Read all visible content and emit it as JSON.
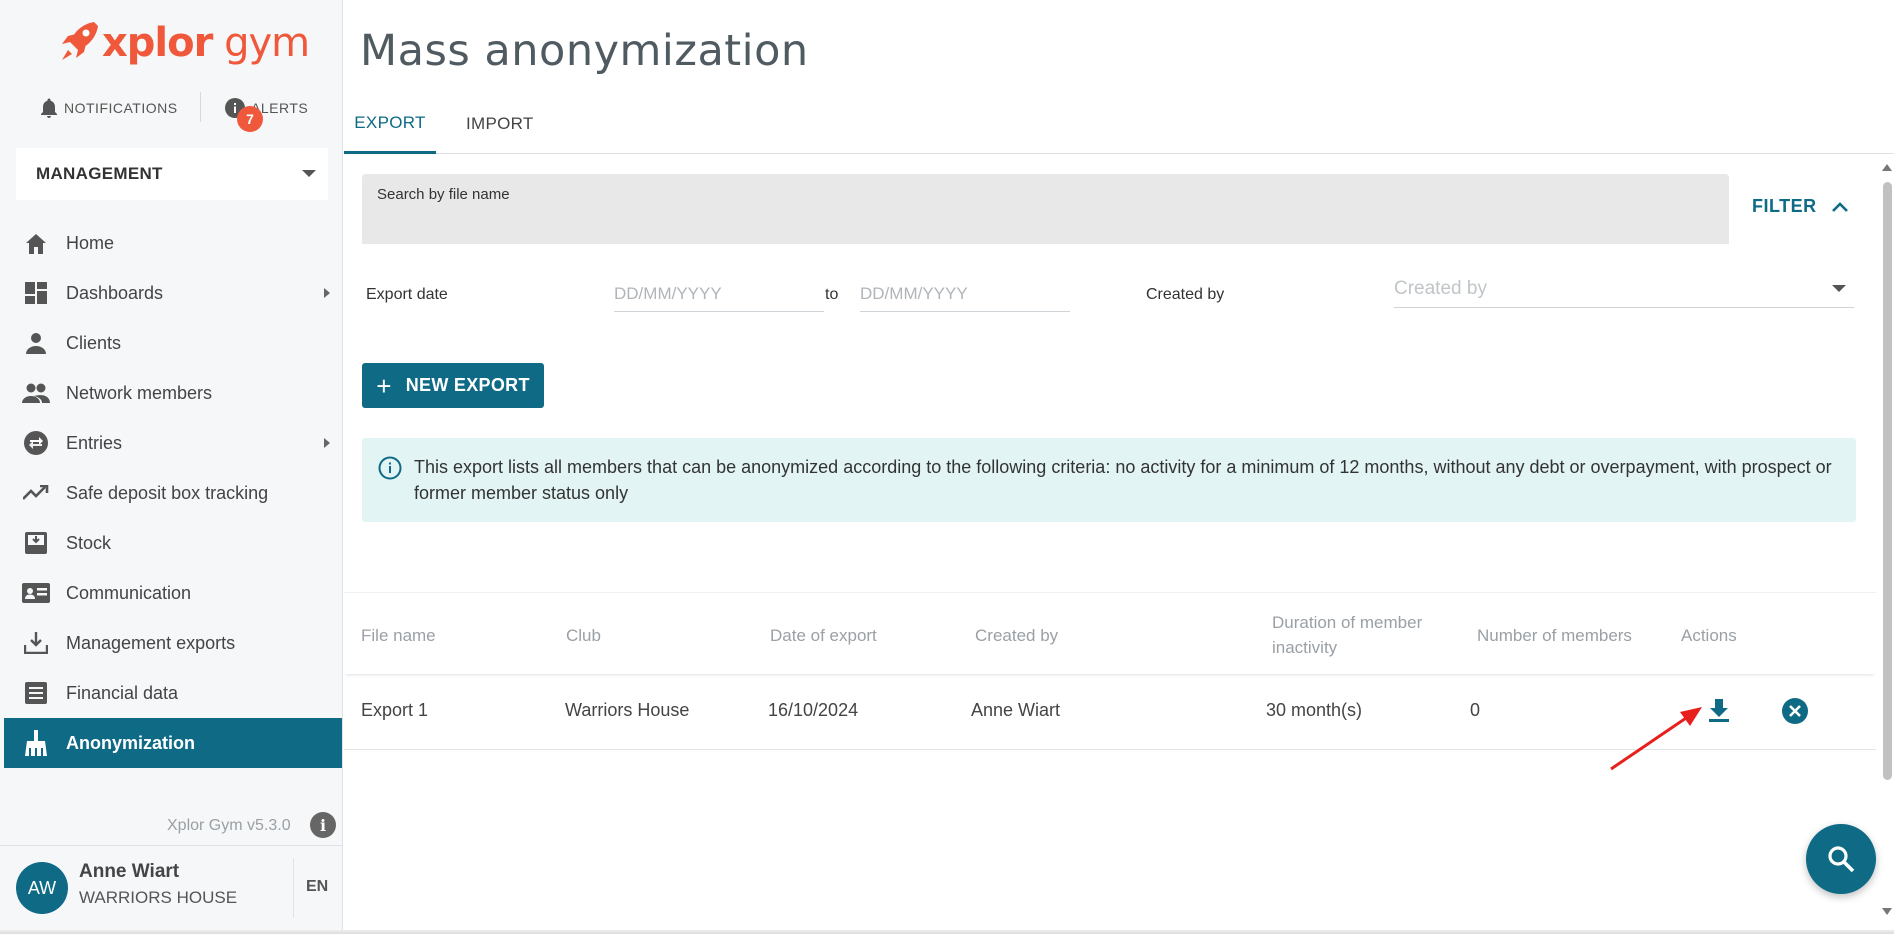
{
  "app": {
    "logo_part1": "xplor",
    "logo_part2": " gym",
    "version": "Xplor Gym v5.3.0"
  },
  "topbar": {
    "notifications_label": "NOTIFICATIONS",
    "alerts_label": "ALERTS",
    "alerts_count": "7"
  },
  "section_select": {
    "value": "MANAGEMENT"
  },
  "sidebar": {
    "items": [
      {
        "label": "Home",
        "icon": "home-icon"
      },
      {
        "label": "Dashboards",
        "icon": "dashboard-icon",
        "has_submenu": true
      },
      {
        "label": "Clients",
        "icon": "person-icon"
      },
      {
        "label": "Network members",
        "icon": "people-icon"
      },
      {
        "label": "Entries",
        "icon": "swap-icon",
        "has_submenu": true
      },
      {
        "label": "Safe deposit box tracking",
        "icon": "trend-icon"
      },
      {
        "label": "Stock",
        "icon": "inbox-icon"
      },
      {
        "label": "Communication",
        "icon": "contact-card-icon"
      },
      {
        "label": "Management exports",
        "icon": "download-tray-icon"
      },
      {
        "label": "Financial data",
        "icon": "list-doc-icon"
      },
      {
        "label": "Anonymization",
        "icon": "broom-icon",
        "active": true
      }
    ]
  },
  "user": {
    "initials": "AW",
    "name": "Anne Wiart",
    "club": "WARRIORS HOUSE",
    "language": "EN"
  },
  "page": {
    "title": "Mass anonymization",
    "tabs": [
      {
        "label": "EXPORT",
        "active": true
      },
      {
        "label": "IMPORT",
        "active": false
      }
    ]
  },
  "filters": {
    "search_label": "Search by file name",
    "search_value": "",
    "filter_button": "FILTER",
    "export_date_label": "Export date",
    "date_from_placeholder": "DD/MM/YYYY",
    "date_to_label": "to",
    "date_to_placeholder": "DD/MM/YYYY",
    "created_by_label": "Created by",
    "created_by_placeholder": "Created by"
  },
  "actions": {
    "new_export": "NEW EXPORT"
  },
  "info_message": "This export lists all members that can be anonymized according to the following criteria: no activity for a minimum of 12 months, without any debt or overpayment, with prospect or former member status only",
  "table": {
    "columns": {
      "file_name": "File name",
      "club": "Club",
      "date_of_export": "Date of export",
      "created_by": "Created by",
      "duration": "Duration of member inactivity",
      "number_of_members": "Number of members",
      "actions": "Actions"
    },
    "rows": [
      {
        "file_name": "Export 1",
        "club": "Warriors House",
        "date_of_export": "16/10/2024",
        "created_by": "Anne Wiart",
        "duration": "30 month(s)",
        "number_of_members": "0"
      }
    ]
  },
  "colors": {
    "primary": "#0e6a85",
    "brand": "#f0583b",
    "info_bg": "#e3f4f4",
    "annotation_arrow": "#e8201d"
  }
}
